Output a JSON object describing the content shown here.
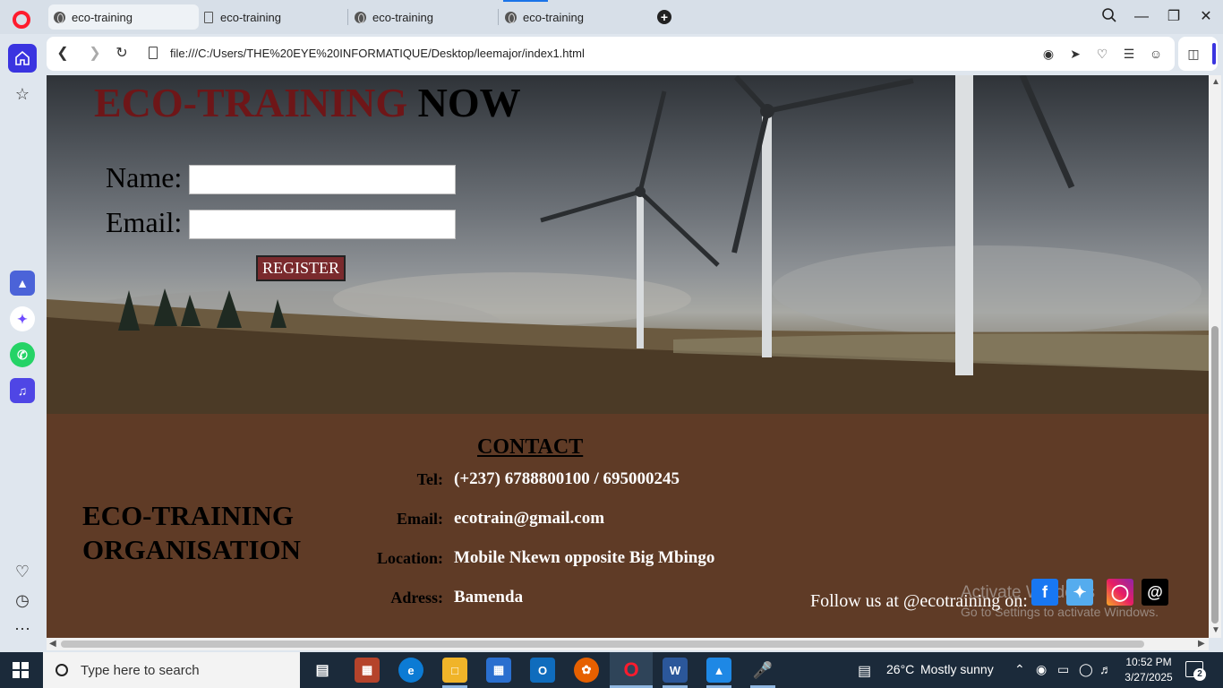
{
  "browser": {
    "tabs": [
      {
        "label": "eco-training",
        "active": true
      },
      {
        "label": "eco-training",
        "active": false
      },
      {
        "label": "eco-training",
        "active": false
      },
      {
        "label": "eco-training",
        "active": false
      }
    ],
    "url": "file:///C:/Users/THE%20EYE%20INFORMATIQUE/Desktop/leemajor/index1.html",
    "accent_color": "#3a34e0"
  },
  "page": {
    "title_part1": "ECO-TRAINING",
    "title_part2": "NOW",
    "title_part1_color": "#6e1618",
    "form": {
      "name_label": "Name:",
      "name_value": "",
      "email_label": "Email:",
      "email_value": "",
      "register_label": "REGISTER"
    },
    "footer": {
      "org_line1": "ECO-TRAINING",
      "org_line2": "ORGANISATION",
      "contact_heading": "CONTACT",
      "contacts": [
        {
          "label": "Tel:",
          "value": "(+237) 6788800100 / 695000245"
        },
        {
          "label": "Email:",
          "value": "ecotrain@gmail.com"
        },
        {
          "label": "Location:",
          "value": "Mobile Nkewn opposite Big Mbingo"
        },
        {
          "label": "Adress:",
          "value": "Bamenda"
        }
      ],
      "follow_text": "Follow us at @ecotraining on:",
      "social_icons": [
        "facebook-icon",
        "twitter-icon",
        "instagram-icon",
        "threads-icon"
      ],
      "background_color": "#5f3b26"
    },
    "watermark_line1": "Activate Windows",
    "watermark_line2": "Go to Settings to activate Windows."
  },
  "taskbar": {
    "search_placeholder": "Type here to search",
    "weather_temp": "26°C",
    "weather_text": "Mostly sunny",
    "time": "10:52 PM",
    "date": "3/27/2025",
    "notification_count": "2"
  }
}
